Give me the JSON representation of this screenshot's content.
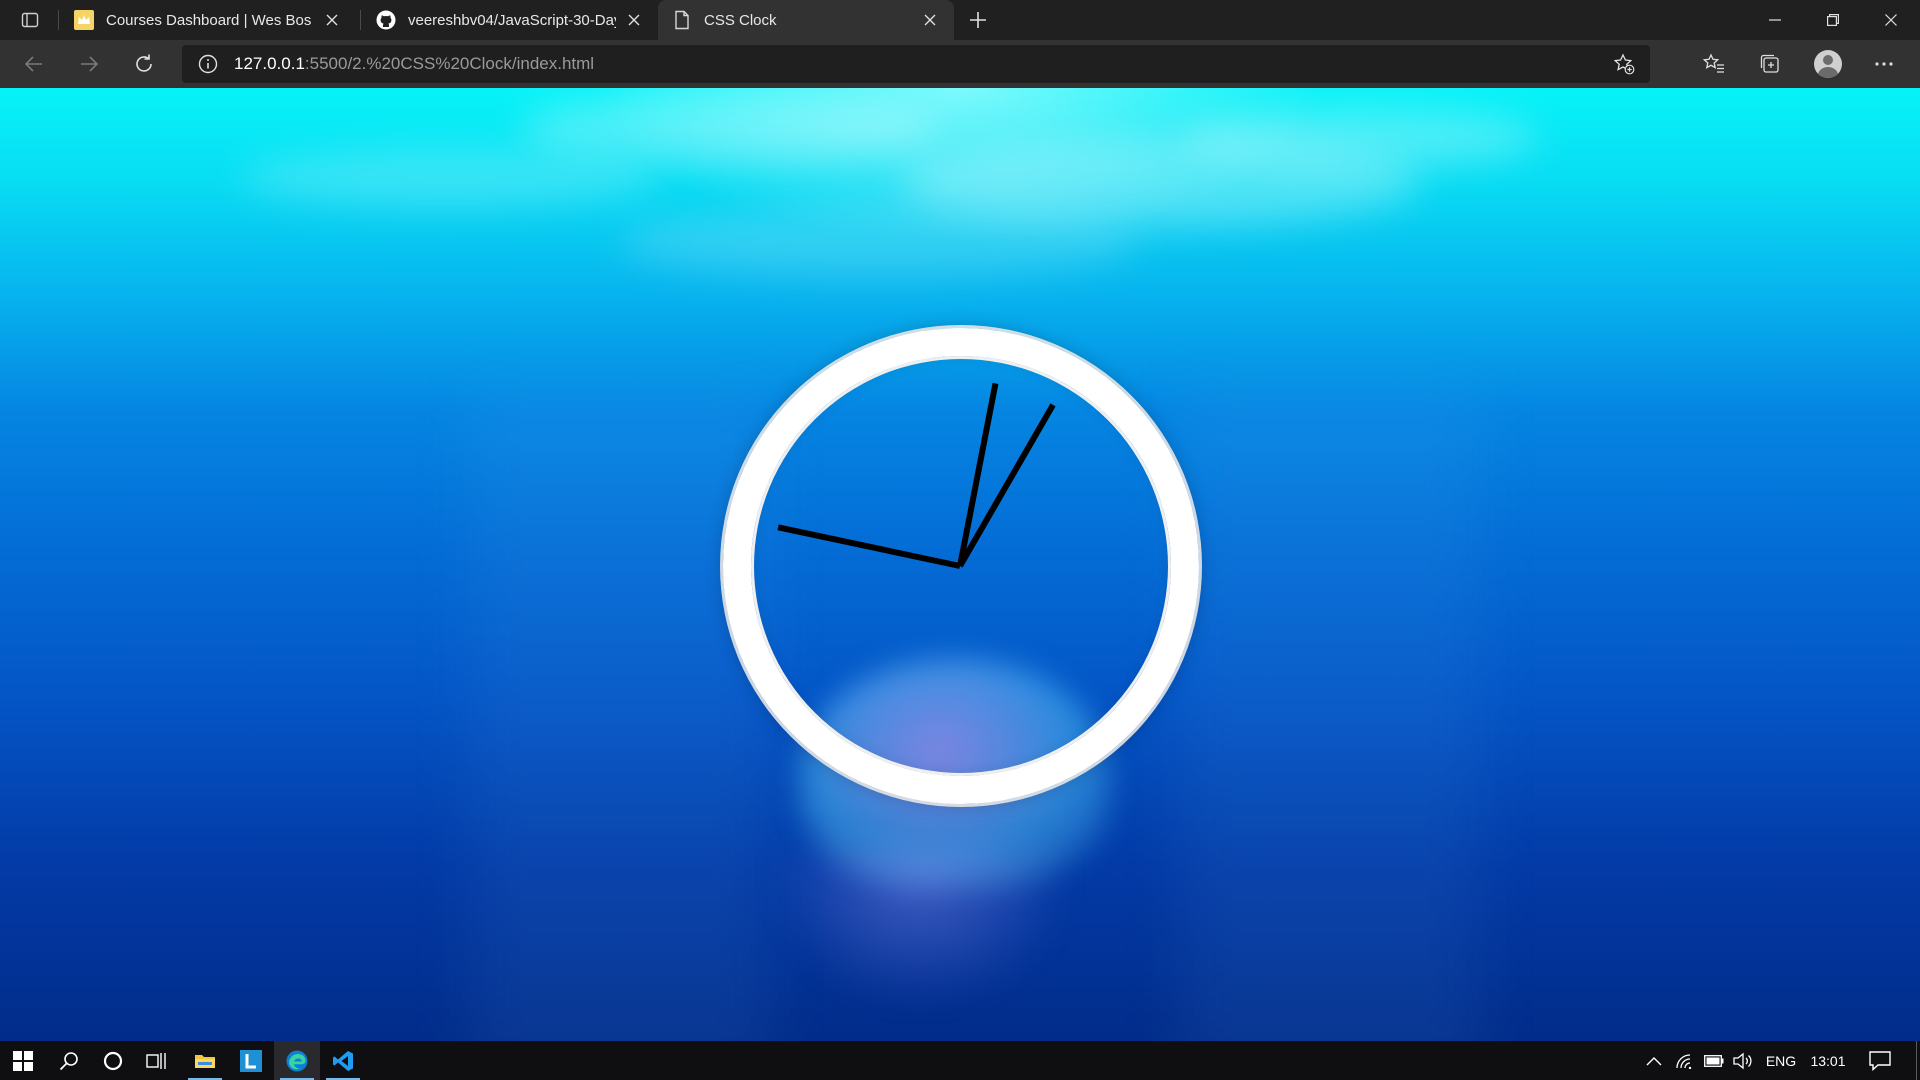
{
  "browser": {
    "tabs": [
      {
        "title": "Courses Dashboard | Wes Bos",
        "icon": "crown-favicon-icon",
        "active": false
      },
      {
        "title": "veereshbv04/JavaScript-30-Days",
        "icon": "github-icon",
        "active": false
      },
      {
        "title": "CSS Clock",
        "icon": "document-icon",
        "active": true
      }
    ],
    "url_host": "127.0.0.1",
    "url_rest": ":5500/2.%20CSS%20Clock/index.html"
  },
  "page": {
    "clock": {
      "hands": [
        {
          "name": "hour-hand",
          "angle_deg": 282
        },
        {
          "name": "minute-hand",
          "angle_deg": 11
        },
        {
          "name": "second-hand",
          "angle_deg": 30
        }
      ]
    }
  },
  "taskbar": {
    "language": "ENG",
    "time": "13:01",
    "colors": {
      "accent": "#76b9ed",
      "background": "#0f0f12"
    }
  }
}
